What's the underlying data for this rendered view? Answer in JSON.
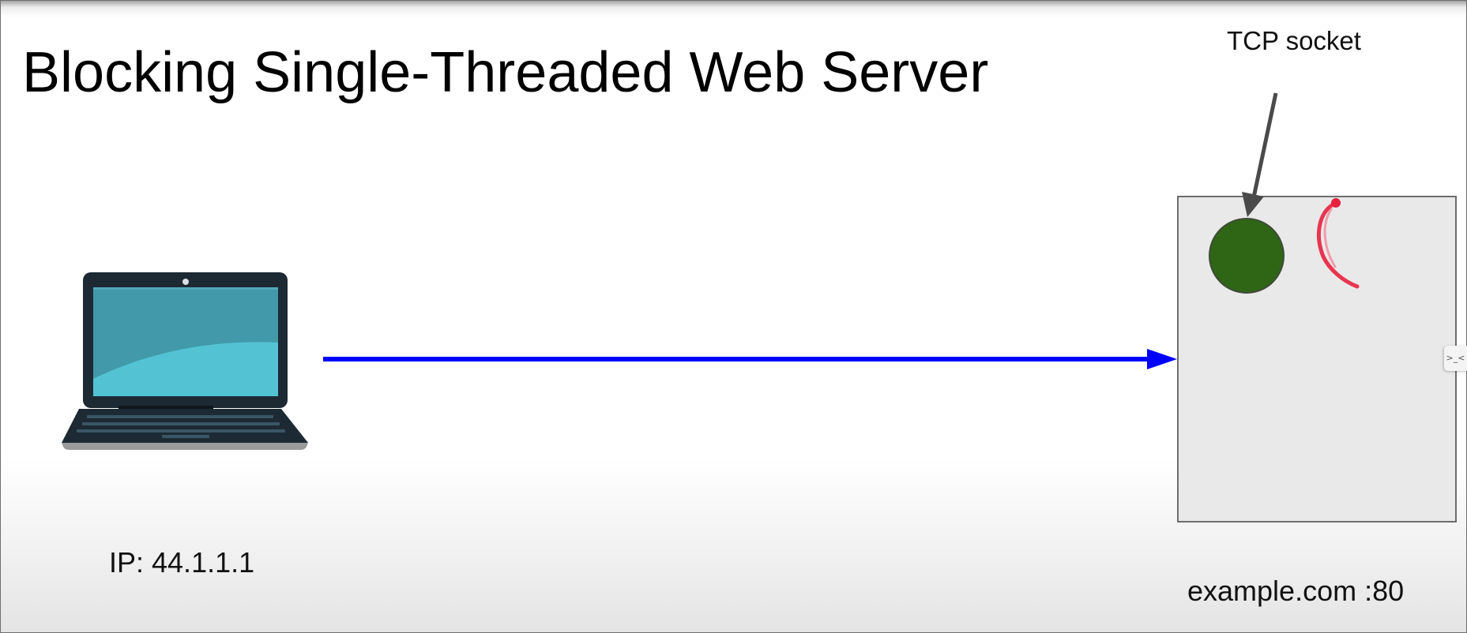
{
  "title": "Blocking Single-Threaded Web Server",
  "client": {
    "ip_label": "IP: 44.1.1.1",
    "icon": "laptop-icon"
  },
  "server": {
    "address_label": "example.com :80",
    "socket_label": "TCP socket"
  },
  "colors": {
    "request_arrow": "#0000ff",
    "socket": "#2e6616",
    "pointer_arrow": "#4a4a4a",
    "annotation": "#e8213f",
    "server_box_fill": "#e9e9e9",
    "server_box_border": "#6d6d6d"
  }
}
